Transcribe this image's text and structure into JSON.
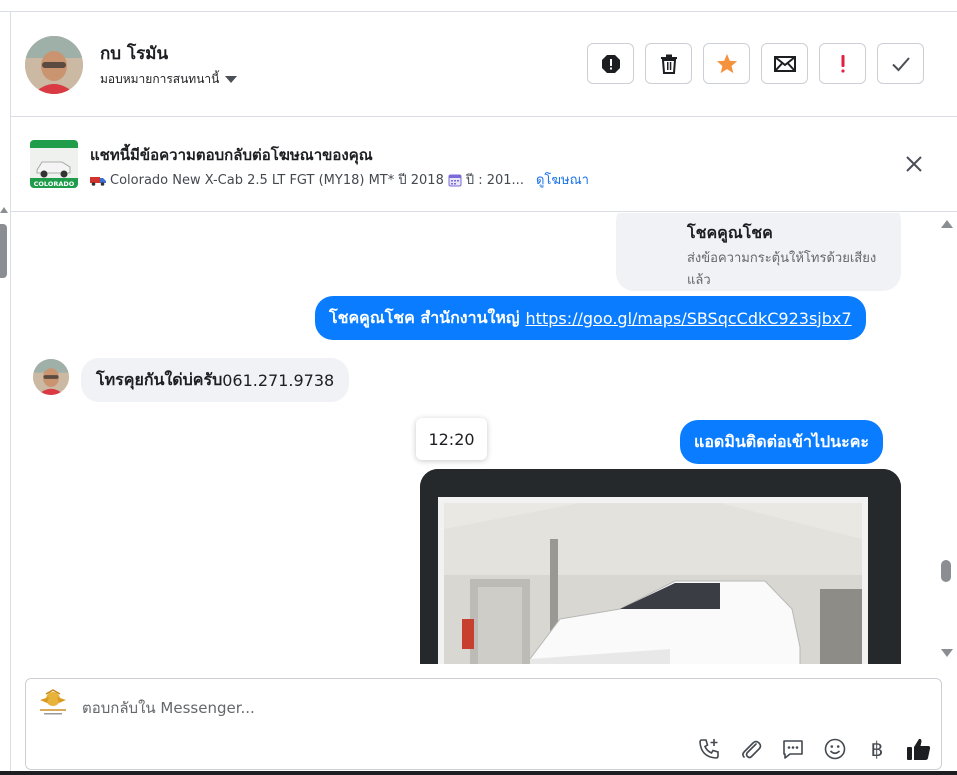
{
  "header": {
    "contact_name": "กบ โรมัน",
    "assign_label": "มอบหมายการสนทนานี้",
    "actions": [
      {
        "name": "spam-button",
        "icon": "alert-octagon-icon"
      },
      {
        "name": "delete-button",
        "icon": "trash-icon"
      },
      {
        "name": "star-button",
        "icon": "star-icon"
      },
      {
        "name": "mark-unread-button",
        "icon": "envelope-icon"
      },
      {
        "name": "follow-up-button",
        "icon": "exclamation-icon"
      },
      {
        "name": "mark-done-button",
        "icon": "check-icon"
      }
    ]
  },
  "ad": {
    "title": "แชทนี้มีข้อความตอบกลับต่อโฆษณาของคุณ",
    "subtitle": "Colorado New X-Cab 2.5 LT FGT (MY18) MT* ปี 2018",
    "year_text": "ปี : 201...",
    "link": "ดูโฆษณา",
    "thumb_label": "COLORADO"
  },
  "messages": {
    "card_title": "โชคคูณโชค",
    "card_desc": "ส่งข้อความกระตุ้นให้โทรด้วยเสียงแล้ว",
    "msg1_text": "โชคคูณโชค สำนักงานใหญ่",
    "msg1_link": "https://goo.gl/maps/SBSqcCdkC923sjbx7",
    "msg_in_text": "โทรคุยกันใด่บ่ครับ",
    "msg_in_number": "061.271.9738",
    "timestamp": "12:20",
    "msg2_text": "แอดมินติดต่อเข้าไปนะคะ"
  },
  "composer": {
    "placeholder": "ตอบกลับใน Messenger..."
  },
  "colors": {
    "brand_blue": "#0a7cff",
    "star_orange": "#f5923e",
    "alert_red": "#e41e3f",
    "bubble_gray": "#f0f2f5"
  }
}
